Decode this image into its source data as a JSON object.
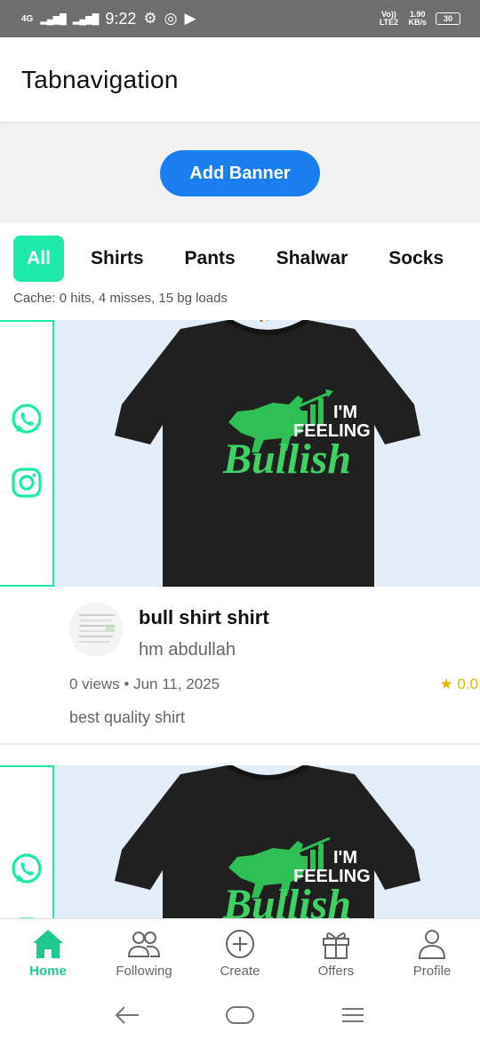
{
  "status_bar": {
    "network": "4G",
    "time": "9:22",
    "volte": "Vo)) LTE2",
    "speed_value": "1.90",
    "speed_unit": "KB/s",
    "battery": "30"
  },
  "app_bar": {
    "title": "Tabnavigation"
  },
  "banner": {
    "add_button_label": "Add Banner"
  },
  "tabs": [
    {
      "label": "All",
      "active": true
    },
    {
      "label": "Shirts"
    },
    {
      "label": "Pants"
    },
    {
      "label": "Shalwar"
    },
    {
      "label": "Socks"
    }
  ],
  "cache_text": "Cache: 0 hits, 4 misses, 15 bg loads",
  "posts": [
    {
      "shirt_text_line1": "I'M",
      "shirt_text_line2": "FEELING",
      "shirt_text_line3": "Bullish",
      "title": "bull shirt shirt",
      "author": "hm abdullah",
      "views_date": "0 views • Jun 11, 2025",
      "rating": "★ 0.0",
      "description": "best quality shirt"
    },
    {
      "shirt_text_line1": "I'M",
      "shirt_text_line2": "FEELING",
      "shirt_text_line3": "Bullish"
    }
  ],
  "bottom_nav": [
    {
      "label": "Home",
      "icon": "home-icon",
      "active": true
    },
    {
      "label": "Following",
      "icon": "people-icon"
    },
    {
      "label": "Create",
      "icon": "plus-circle-icon"
    },
    {
      "label": "Offers",
      "icon": "gift-icon"
    },
    {
      "label": "Profile",
      "icon": "person-icon"
    }
  ],
  "colors": {
    "accent": "#1de9a8",
    "primary_button": "#1a7ef0",
    "status_bar": "#6e6e6e"
  }
}
